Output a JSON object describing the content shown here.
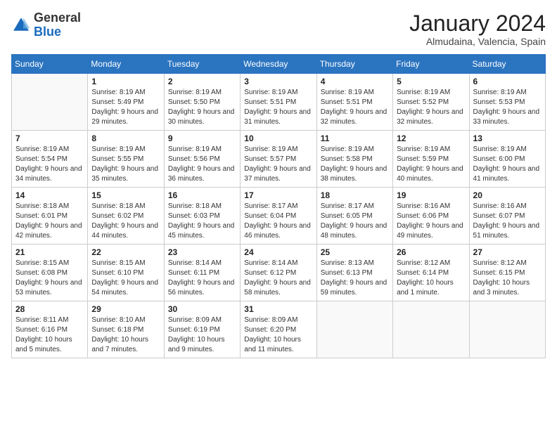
{
  "header": {
    "logo_general": "General",
    "logo_blue": "Blue",
    "month_title": "January 2024",
    "subtitle": "Almudaina, Valencia, Spain"
  },
  "days_of_week": [
    "Sunday",
    "Monday",
    "Tuesday",
    "Wednesday",
    "Thursday",
    "Friday",
    "Saturday"
  ],
  "weeks": [
    [
      {
        "num": "",
        "sunrise": "",
        "sunset": "",
        "daylight": "",
        "empty": true
      },
      {
        "num": "1",
        "sunrise": "Sunrise: 8:19 AM",
        "sunset": "Sunset: 5:49 PM",
        "daylight": "Daylight: 9 hours and 29 minutes.",
        "empty": false
      },
      {
        "num": "2",
        "sunrise": "Sunrise: 8:19 AM",
        "sunset": "Sunset: 5:50 PM",
        "daylight": "Daylight: 9 hours and 30 minutes.",
        "empty": false
      },
      {
        "num": "3",
        "sunrise": "Sunrise: 8:19 AM",
        "sunset": "Sunset: 5:51 PM",
        "daylight": "Daylight: 9 hours and 31 minutes.",
        "empty": false
      },
      {
        "num": "4",
        "sunrise": "Sunrise: 8:19 AM",
        "sunset": "Sunset: 5:51 PM",
        "daylight": "Daylight: 9 hours and 32 minutes.",
        "empty": false
      },
      {
        "num": "5",
        "sunrise": "Sunrise: 8:19 AM",
        "sunset": "Sunset: 5:52 PM",
        "daylight": "Daylight: 9 hours and 32 minutes.",
        "empty": false
      },
      {
        "num": "6",
        "sunrise": "Sunrise: 8:19 AM",
        "sunset": "Sunset: 5:53 PM",
        "daylight": "Daylight: 9 hours and 33 minutes.",
        "empty": false
      }
    ],
    [
      {
        "num": "7",
        "sunrise": "Sunrise: 8:19 AM",
        "sunset": "Sunset: 5:54 PM",
        "daylight": "Daylight: 9 hours and 34 minutes.",
        "empty": false
      },
      {
        "num": "8",
        "sunrise": "Sunrise: 8:19 AM",
        "sunset": "Sunset: 5:55 PM",
        "daylight": "Daylight: 9 hours and 35 minutes.",
        "empty": false
      },
      {
        "num": "9",
        "sunrise": "Sunrise: 8:19 AM",
        "sunset": "Sunset: 5:56 PM",
        "daylight": "Daylight: 9 hours and 36 minutes.",
        "empty": false
      },
      {
        "num": "10",
        "sunrise": "Sunrise: 8:19 AM",
        "sunset": "Sunset: 5:57 PM",
        "daylight": "Daylight: 9 hours and 37 minutes.",
        "empty": false
      },
      {
        "num": "11",
        "sunrise": "Sunrise: 8:19 AM",
        "sunset": "Sunset: 5:58 PM",
        "daylight": "Daylight: 9 hours and 38 minutes.",
        "empty": false
      },
      {
        "num": "12",
        "sunrise": "Sunrise: 8:19 AM",
        "sunset": "Sunset: 5:59 PM",
        "daylight": "Daylight: 9 hours and 40 minutes.",
        "empty": false
      },
      {
        "num": "13",
        "sunrise": "Sunrise: 8:19 AM",
        "sunset": "Sunset: 6:00 PM",
        "daylight": "Daylight: 9 hours and 41 minutes.",
        "empty": false
      }
    ],
    [
      {
        "num": "14",
        "sunrise": "Sunrise: 8:18 AM",
        "sunset": "Sunset: 6:01 PM",
        "daylight": "Daylight: 9 hours and 42 minutes.",
        "empty": false
      },
      {
        "num": "15",
        "sunrise": "Sunrise: 8:18 AM",
        "sunset": "Sunset: 6:02 PM",
        "daylight": "Daylight: 9 hours and 44 minutes.",
        "empty": false
      },
      {
        "num": "16",
        "sunrise": "Sunrise: 8:18 AM",
        "sunset": "Sunset: 6:03 PM",
        "daylight": "Daylight: 9 hours and 45 minutes.",
        "empty": false
      },
      {
        "num": "17",
        "sunrise": "Sunrise: 8:17 AM",
        "sunset": "Sunset: 6:04 PM",
        "daylight": "Daylight: 9 hours and 46 minutes.",
        "empty": false
      },
      {
        "num": "18",
        "sunrise": "Sunrise: 8:17 AM",
        "sunset": "Sunset: 6:05 PM",
        "daylight": "Daylight: 9 hours and 48 minutes.",
        "empty": false
      },
      {
        "num": "19",
        "sunrise": "Sunrise: 8:16 AM",
        "sunset": "Sunset: 6:06 PM",
        "daylight": "Daylight: 9 hours and 49 minutes.",
        "empty": false
      },
      {
        "num": "20",
        "sunrise": "Sunrise: 8:16 AM",
        "sunset": "Sunset: 6:07 PM",
        "daylight": "Daylight: 9 hours and 51 minutes.",
        "empty": false
      }
    ],
    [
      {
        "num": "21",
        "sunrise": "Sunrise: 8:15 AM",
        "sunset": "Sunset: 6:08 PM",
        "daylight": "Daylight: 9 hours and 53 minutes.",
        "empty": false
      },
      {
        "num": "22",
        "sunrise": "Sunrise: 8:15 AM",
        "sunset": "Sunset: 6:10 PM",
        "daylight": "Daylight: 9 hours and 54 minutes.",
        "empty": false
      },
      {
        "num": "23",
        "sunrise": "Sunrise: 8:14 AM",
        "sunset": "Sunset: 6:11 PM",
        "daylight": "Daylight: 9 hours and 56 minutes.",
        "empty": false
      },
      {
        "num": "24",
        "sunrise": "Sunrise: 8:14 AM",
        "sunset": "Sunset: 6:12 PM",
        "daylight": "Daylight: 9 hours and 58 minutes.",
        "empty": false
      },
      {
        "num": "25",
        "sunrise": "Sunrise: 8:13 AM",
        "sunset": "Sunset: 6:13 PM",
        "daylight": "Daylight: 9 hours and 59 minutes.",
        "empty": false
      },
      {
        "num": "26",
        "sunrise": "Sunrise: 8:12 AM",
        "sunset": "Sunset: 6:14 PM",
        "daylight": "Daylight: 10 hours and 1 minute.",
        "empty": false
      },
      {
        "num": "27",
        "sunrise": "Sunrise: 8:12 AM",
        "sunset": "Sunset: 6:15 PM",
        "daylight": "Daylight: 10 hours and 3 minutes.",
        "empty": false
      }
    ],
    [
      {
        "num": "28",
        "sunrise": "Sunrise: 8:11 AM",
        "sunset": "Sunset: 6:16 PM",
        "daylight": "Daylight: 10 hours and 5 minutes.",
        "empty": false
      },
      {
        "num": "29",
        "sunrise": "Sunrise: 8:10 AM",
        "sunset": "Sunset: 6:18 PM",
        "daylight": "Daylight: 10 hours and 7 minutes.",
        "empty": false
      },
      {
        "num": "30",
        "sunrise": "Sunrise: 8:09 AM",
        "sunset": "Sunset: 6:19 PM",
        "daylight": "Daylight: 10 hours and 9 minutes.",
        "empty": false
      },
      {
        "num": "31",
        "sunrise": "Sunrise: 8:09 AM",
        "sunset": "Sunset: 6:20 PM",
        "daylight": "Daylight: 10 hours and 11 minutes.",
        "empty": false
      },
      {
        "num": "",
        "sunrise": "",
        "sunset": "",
        "daylight": "",
        "empty": true
      },
      {
        "num": "",
        "sunrise": "",
        "sunset": "",
        "daylight": "",
        "empty": true
      },
      {
        "num": "",
        "sunrise": "",
        "sunset": "",
        "daylight": "",
        "empty": true
      }
    ]
  ]
}
